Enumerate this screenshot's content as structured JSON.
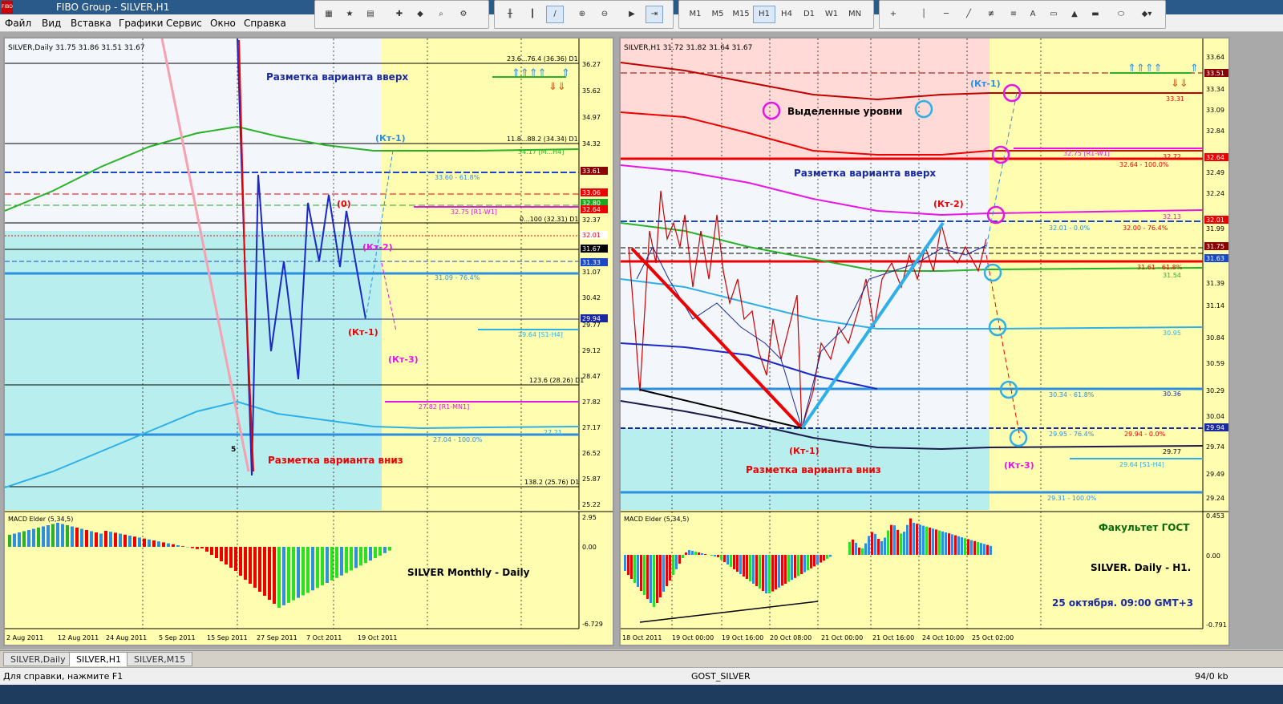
{
  "window": {
    "title": "FIBO Group - SILVER,H1",
    "logo": "FIBO"
  },
  "menu": [
    "Файл",
    "Вид",
    "Вставка",
    "Графики",
    "Сервис",
    "Окно",
    "Справка"
  ],
  "toolbar": {
    "timeframes": [
      "M1",
      "M5",
      "M15",
      "H1",
      "H4",
      "D1",
      "W1",
      "MN"
    ],
    "active_timeframe": "H1",
    "draw_labels": [
      "A"
    ]
  },
  "left_chart": {
    "header": "SILVER,Daily  31.75 31.86 31.51 31.67",
    "price_labels": [
      "36.27",
      "35.62",
      "34.97",
      "34.32",
      "33.61",
      "33.06",
      "32.80",
      "32.64",
      "32.37",
      "32.01",
      "31.67",
      "31.33",
      "31.07",
      "30.42",
      "29.94",
      "29.77",
      "29.12",
      "28.47",
      "27.82",
      "27.17",
      "26.52",
      "25.87",
      "25.22"
    ],
    "date_labels": [
      "2 Aug 2011",
      "12 Aug 2011",
      "24 Aug 2011",
      "5 Sep 2011",
      "15 Sep 2011",
      "27 Sep 2011",
      "7 Oct 2011",
      "19 Oct 2011"
    ],
    "texts": {
      "up_marking": "Разметка варианта вверх",
      "down_marking": "Разметка варианта вниз",
      "kt1_blue": "(Кт-1)",
      "kt1_red": "(Кт-1)",
      "kt2": "(Кт-2)",
      "kt3": "(Кт-3)",
      "zero": "(0)",
      "fib_top": "23.6...76.4 (36.36) D1",
      "fib_11": "11.8...88.2 (34.34) D1",
      "fib_0": "0...100 (32.31) D1",
      "fib_123": "123.6 (28.26) D1",
      "fib_138": "138.2 (25.76) D1",
      "lvl_3360": "33.60 - 61.8%",
      "lvl_3275": "32.75 [R1-W1]",
      "lvl_3109": "31.09 - 76.4%",
      "lvl_2964": "29.64 [S1-H4]",
      "lvl_2782": "27.82 [R1-MN1]",
      "lvl_2704": "27.04 - 100.0%",
      "lvl_2721": "27.21",
      "lvl_3417": "34.17 [M...H4]",
      "wave5": "5"
    },
    "macd": {
      "header": "MACD Elder (5,34,5)",
      "scale": [
        "2.95",
        "0.00",
        "-6.729"
      ],
      "caption": "SILVER  Monthly - Daily"
    }
  },
  "right_chart": {
    "header": "SILVER,H1  31.72 31.82 31.64 31.67",
    "price_labels": [
      "33.64",
      "33.51",
      "33.34",
      "33.09",
      "32.84",
      "32.64",
      "32.49",
      "32.24",
      "32.01",
      "31.99",
      "31.75",
      "31.63",
      "31.39",
      "31.14",
      "30.84",
      "30.59",
      "30.29",
      "30.04",
      "29.94",
      "29.74",
      "29.49",
      "29.24"
    ],
    "date_labels": [
      "18 Oct 2011",
      "19 Oct 00:00",
      "19 Oct 16:00",
      "20 Oct 08:00",
      "21 Oct 00:00",
      "21 Oct 16:00",
      "24 Oct 10:00",
      "25 Oct 02:00"
    ],
    "texts": {
      "selected_levels": "Выделенные уровни",
      "up_marking": "Разметка варианта вверх",
      "down_marking": "Разметка варианта вниз",
      "kt1_top": "(Кт-1)",
      "kt2": "(Кт-2)",
      "kt1_bottom": "(Кт-1)",
      "kt3": "(Кт-3)",
      "lvl_3331": "33.31",
      "lvl_3275": "32.75 [R1-W1]",
      "lvl_3272": "32.72",
      "lvl_3264": "32.64 - 100.0%",
      "lvl_3213": "32.13",
      "lvl_3201": "32.01 - 0.0%",
      "lvl_3200": "32.00 - 76.4%",
      "lvl_3161": "31.61 - 61.8%",
      "lvl_3154": "31.54",
      "lvl_3095": "30.95",
      "lvl_3034": "30.34 - 61.8%",
      "lvl_3036": "30.36",
      "lvl_2995": "29.95 - 76.4%",
      "lvl_2994": "29.94 - 0.0%",
      "lvl_2977": "29.77",
      "lvl_2964": "29.64 [S1-H4]",
      "lvl_2931": "29.31 - 100.0%"
    },
    "macd": {
      "header": "MACD Elder (5,34,5)",
      "scale": [
        "0.453",
        "0.00",
        "-0.791"
      ],
      "faculty": "Факультет ГОСТ",
      "caption": "SILVER. Daily - H1.",
      "date": "25 октября. 09:00 GMT+3"
    }
  },
  "tabs": [
    "SILVER,Daily",
    "SILVER,H1",
    "SILVER,M15"
  ],
  "active_tab": "SILVER,H1",
  "status": {
    "help": "Для справки, нажмите F1",
    "profile": "GOST_SILVER",
    "traffic": "94/0 kb"
  },
  "colors": {
    "chart_bg": "#fffeb0",
    "cyan_zone": "#b8eeee",
    "pink_zone": "#ffdad6",
    "blue_zone": "#f3f6fb"
  }
}
